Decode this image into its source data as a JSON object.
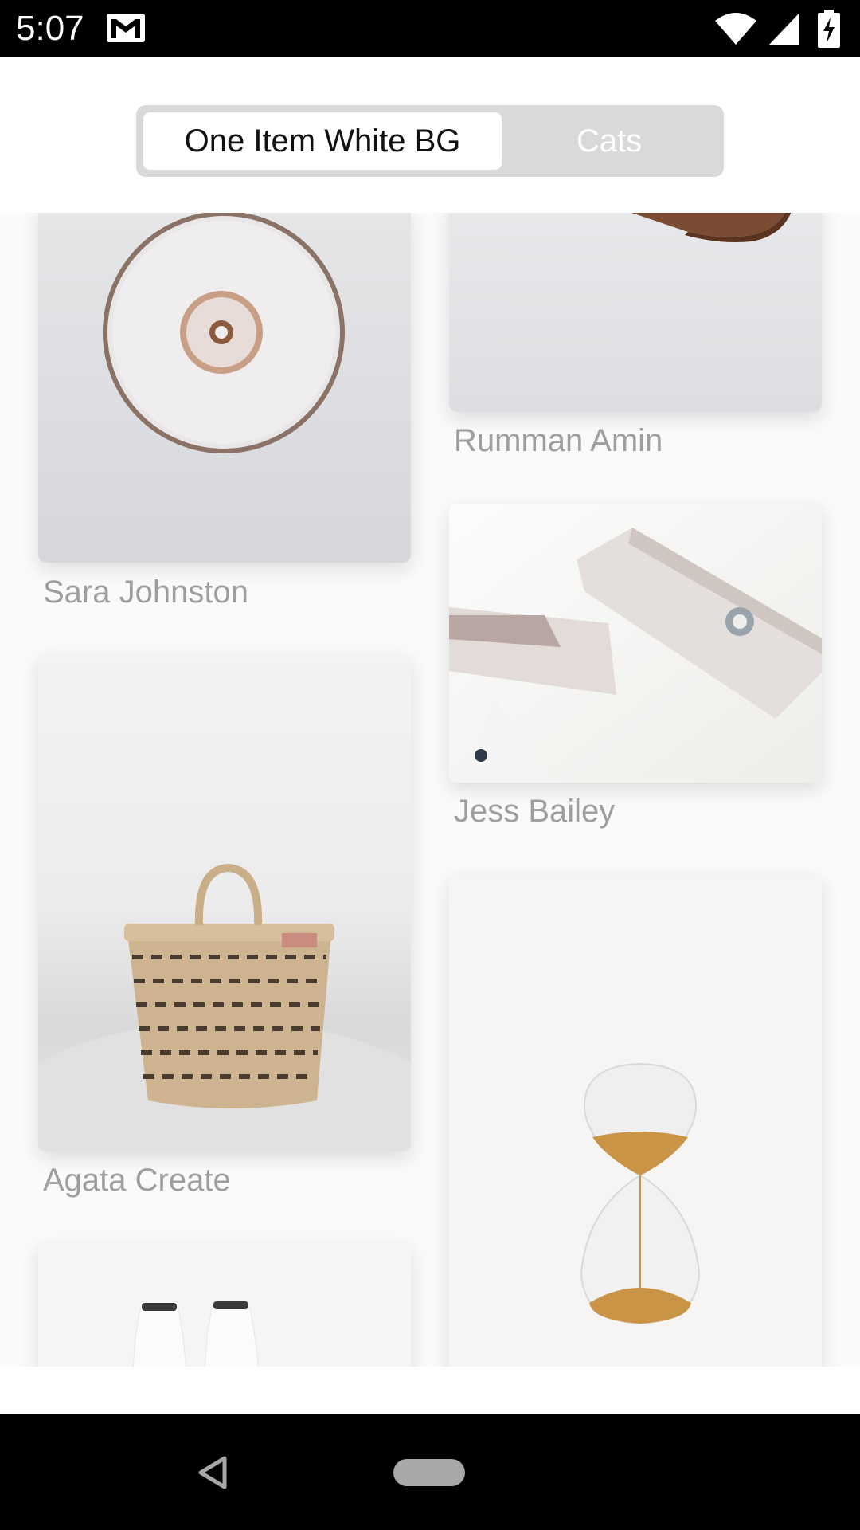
{
  "status_bar": {
    "time": "5:07",
    "icons": [
      "gmail-icon",
      "wifi-icon",
      "signal-icon",
      "battery-charging-icon"
    ]
  },
  "segmented_control": {
    "tabs": [
      {
        "label": "One Item White BG",
        "selected": true
      },
      {
        "label": "Cats",
        "selected": false
      }
    ]
  },
  "gallery": {
    "left_column": [
      {
        "caption": "Sara Johnston",
        "image": "donut-on-plate"
      },
      {
        "caption": "Agata Create",
        "image": "wicker-basket"
      },
      {
        "caption": "",
        "image": "white-bottles"
      }
    ],
    "right_column": [
      {
        "caption": "Rumman Amin",
        "image": "wooden-board-corner"
      },
      {
        "caption": "Jess Bailey",
        "image": "wooden-clothespins"
      },
      {
        "caption": "",
        "image": "hourglass"
      }
    ]
  },
  "nav_bar": {
    "icons": [
      "back-icon",
      "home-pill"
    ]
  }
}
